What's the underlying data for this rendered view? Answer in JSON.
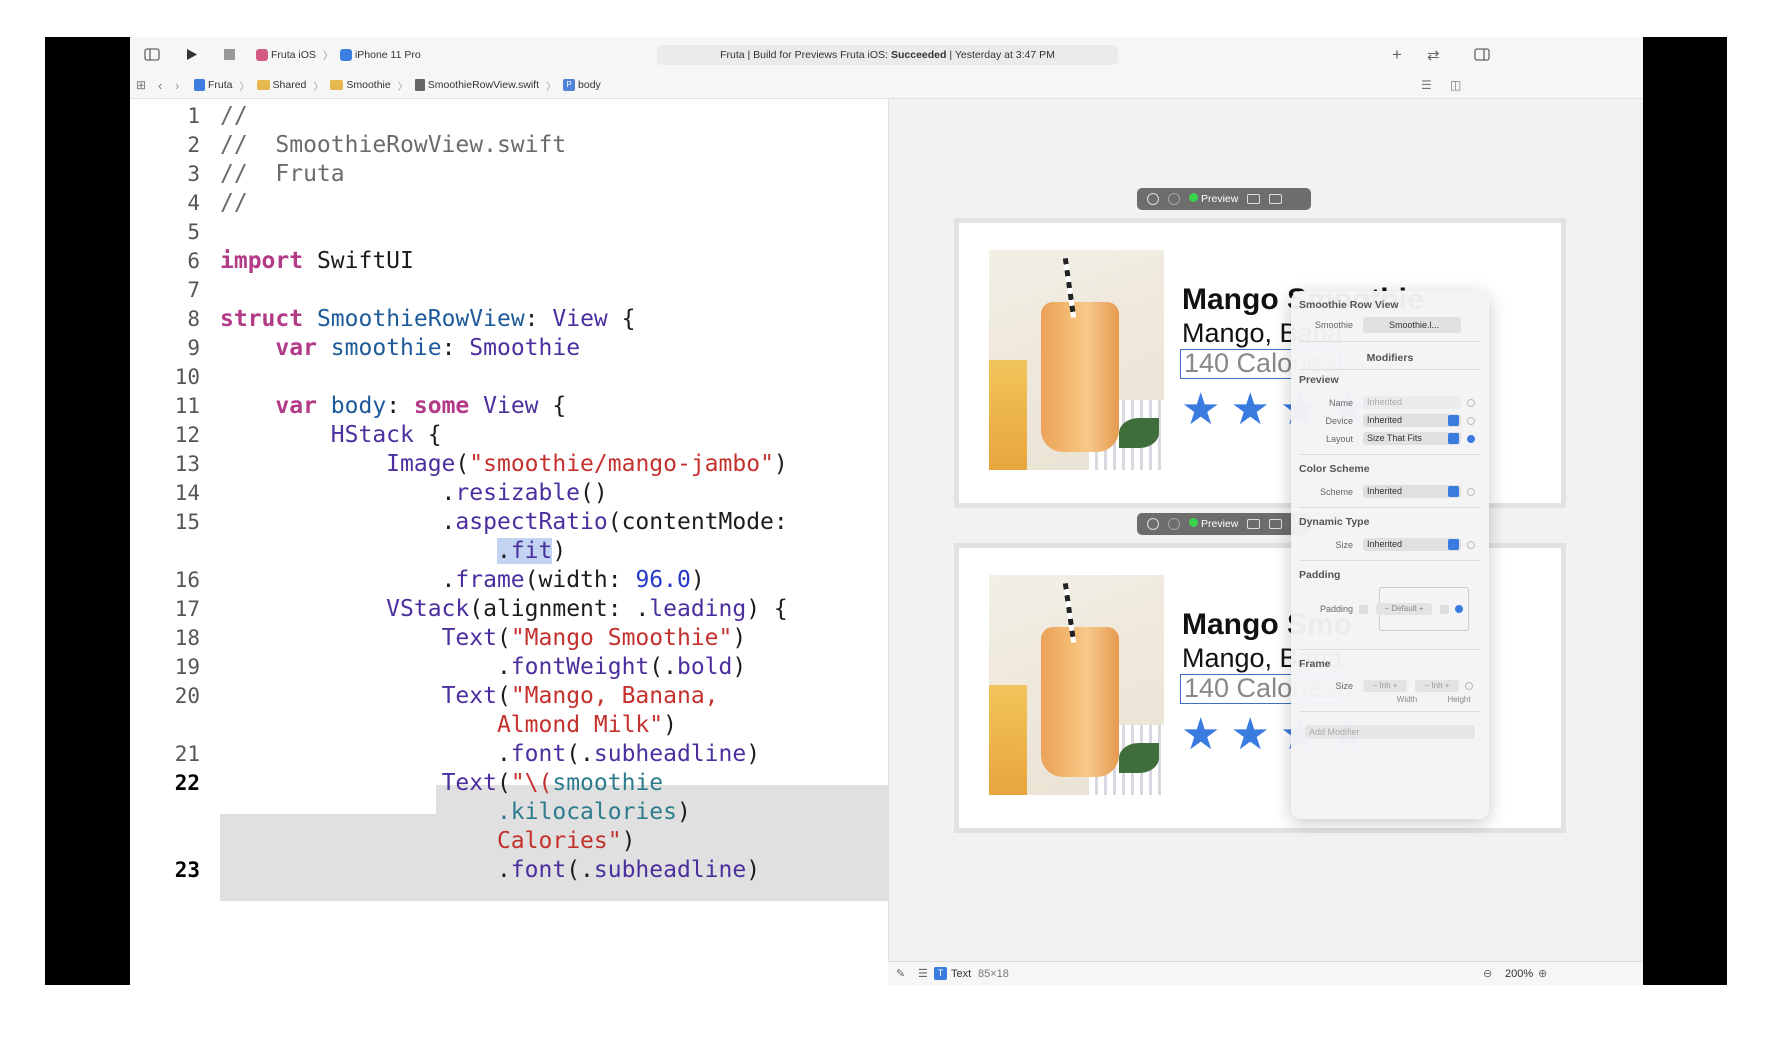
{
  "toolbar": {
    "scheme_app": "Fruta iOS",
    "scheme_device": "iPhone 11 Pro",
    "status_prefix": "Fruta | Build for Previews Fruta iOS:",
    "status_result": "Succeeded",
    "status_time": "| Yesterday at 3:47 PM"
  },
  "jumpbar": {
    "crumbs": [
      "Fruta",
      "Shared",
      "Smoothie",
      "SmoothieRowView.swift",
      "body"
    ]
  },
  "editor": {
    "line_numbers": [
      "1",
      "2",
      "3",
      "4",
      "5",
      "6",
      "7",
      "8",
      "9",
      "10",
      "11",
      "12",
      "13",
      "14",
      "15",
      "",
      "16",
      "17",
      "18",
      "19",
      "20",
      "",
      "21",
      "22",
      "",
      "",
      "23"
    ],
    "current_line": "22"
  },
  "preview": {
    "bar_label": "Preview",
    "card_title": "Mango Smoothie",
    "card_title_clipped": "Mango Smo",
    "card_subtitle": "Mango, Bana",
    "card_calories": "140 Calories",
    "star_glyph": "★",
    "accent": "#3a7be0"
  },
  "inspector": {
    "header": "Smoothie Row View",
    "smoothie_label": "Smoothie",
    "smoothie_value": "Smoothie.l...",
    "modifiers": "Modifiers",
    "preview_section": "Preview",
    "name_label": "Name",
    "name_placeholder": "Inherited",
    "device_label": "Device",
    "device_value": "Inherited",
    "layout_label": "Layout",
    "layout_value": "Size That Fits",
    "color_section": "Color Scheme",
    "scheme_label": "Scheme",
    "scheme_value": "Inherited",
    "dynamic_section": "Dynamic Type",
    "size_label": "Size",
    "size_value": "Inherited",
    "padding_section": "Padding",
    "padding_label": "Padding",
    "padding_value": "Default",
    "frame_section": "Frame",
    "frame_size_label": "Size",
    "frame_width_value": "Inh",
    "frame_height_value": "Inh",
    "width_caption": "Width",
    "height_caption": "Height",
    "add_modifier": "Add Modifier"
  },
  "statusbar": {
    "selection_type": "Text",
    "selection_size": "85×18",
    "zoom": "200%"
  }
}
